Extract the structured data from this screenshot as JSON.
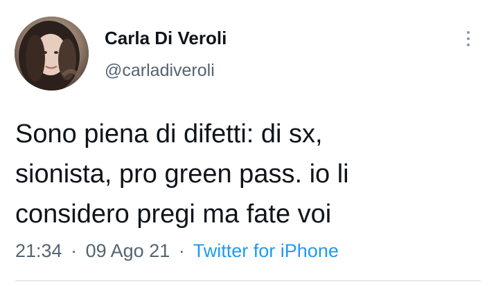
{
  "author": {
    "display_name": "Carla Di Veroli",
    "handle": "@carladiveroli"
  },
  "tweet": {
    "lines": [
      "Sono piena di difetti: di sx,",
      "sionista, pro green pass. io li",
      "considero pregi ma fate voi"
    ]
  },
  "meta": {
    "time": "21:34",
    "separator": "·",
    "date": "09 Ago 21",
    "source": "Twitter for iPhone"
  },
  "icons": {
    "more": "more-vertical-icon"
  },
  "colors": {
    "text": "#0f1419",
    "secondary": "#536471",
    "link": "#1d9bf0"
  }
}
